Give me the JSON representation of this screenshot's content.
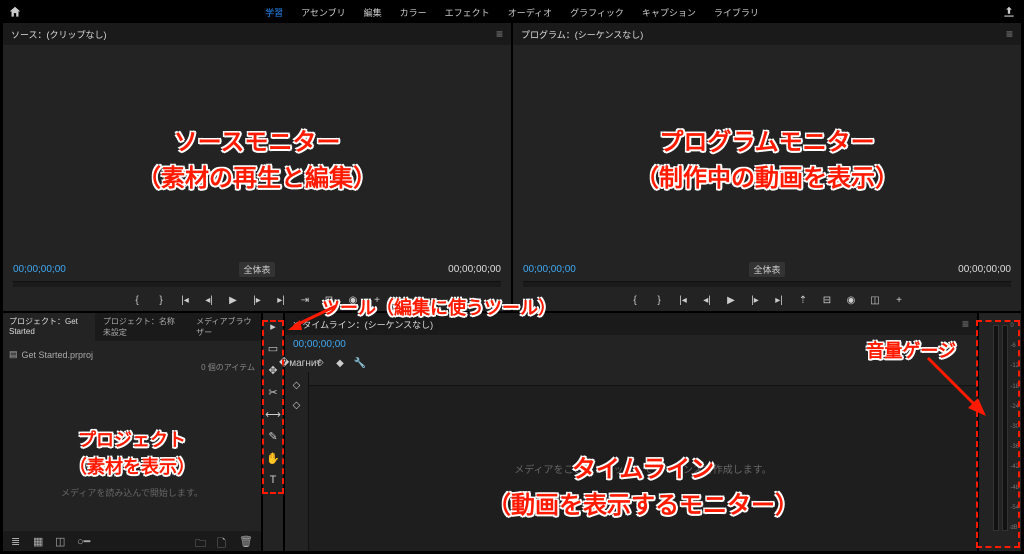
{
  "workspaces": [
    "学習",
    "アセンブリ",
    "編集",
    "カラー",
    "エフェクト",
    "オーディオ",
    "グラフィック",
    "キャプション",
    "ライブラリ"
  ],
  "workspace_active_index": 0,
  "source_panel": {
    "title": "ソース：(クリップなし)",
    "tc_left": "00;00;00;00",
    "tc_right": "00;00;00;00",
    "fit": "全体表"
  },
  "program_panel": {
    "title": "プログラム：(シーケンスなし)",
    "tc_left": "00;00;00;00",
    "tc_right": "00;00;00;00",
    "fit": "全体表"
  },
  "project_tabs": [
    "プロジェクト：Get Started",
    "プロジェクト：名称未設定",
    "メディアブラウザー"
  ],
  "project_file": "Get Started.prproj",
  "project_items": "0 個のアイテム",
  "project_hint": "メディアを読み込んで開始します。",
  "timeline_title": "タイムライン：(シーケンスなし)",
  "timeline_tc": "00;00;00;00",
  "timeline_hint": "メディアをここにドロップしてシーケンスを作成します。",
  "audio_scale": [
    "0",
    "-6",
    "-12",
    "-18",
    "-24",
    "-30",
    "-36",
    "-42",
    "-48",
    "-54",
    "dB"
  ],
  "annotations": {
    "source": "ソースモニター\n（素材の再生と編集）",
    "program": "プログラムモニター\n（制作中の動画を表示）",
    "tools": "ツール（編集に使うツール）",
    "project": "プロジェクト\n（素材を表示）",
    "timeline": "タイムライン\n（動画を表示するモニター）",
    "audio": "音量ゲージ"
  },
  "icons": {
    "tools": [
      "▸",
      "▭",
      "✥",
      "✂",
      "⟷",
      "✎",
      "✋",
      "T"
    ]
  }
}
